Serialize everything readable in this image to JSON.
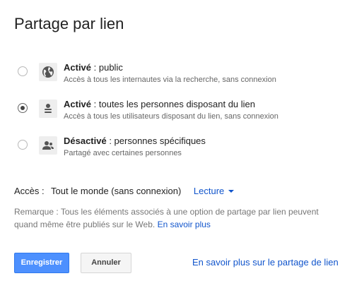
{
  "dialog": {
    "title": "Partage par lien"
  },
  "options": [
    {
      "status": "Activé",
      "description": " : public",
      "detail": "Accès à tous les internautes via la recherche, sans connexion",
      "icon": "globe-icon",
      "selected": false
    },
    {
      "status": "Activé",
      "description": " : toutes les personnes disposant du lien",
      "detail": "Accès à tous les utilisateurs disposant du lien, sans connexion",
      "icon": "link-user-icon",
      "selected": true
    },
    {
      "status": "Désactivé",
      "description": " : personnes spécifiques",
      "detail": "Partagé avec certaines personnes",
      "icon": "people-icon",
      "selected": false
    }
  ],
  "access": {
    "label": "Accès :",
    "value": "Tout le monde (sans connexion)",
    "dropdown": "Lecture"
  },
  "remark": {
    "text": "Remarque : Tous les éléments associés à une option de partage par lien peuvent quand même être publiés sur le Web. ",
    "link": "En savoir plus"
  },
  "buttons": {
    "save": "Enregistrer",
    "cancel": "Annuler"
  },
  "help_link": "En savoir plus sur le partage de lien",
  "colors": {
    "primary": "#4d90fe",
    "link": "#1155cc"
  }
}
